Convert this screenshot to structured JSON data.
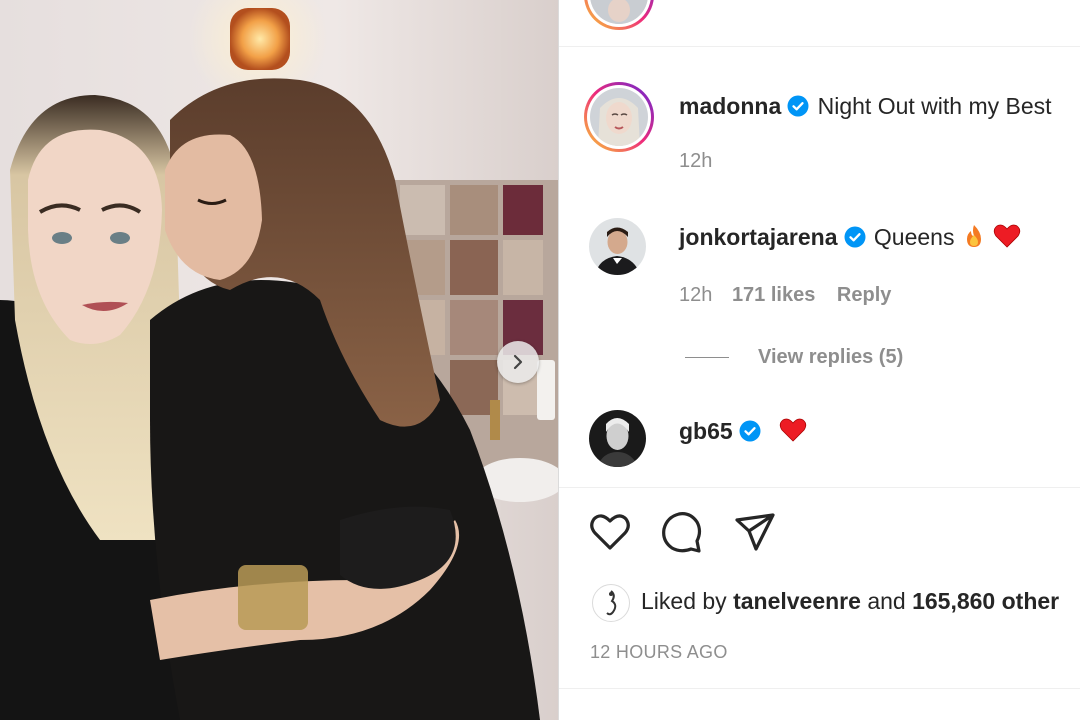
{
  "post": {
    "author": "madonna",
    "caption": "Night Out with my Best",
    "time": "12h"
  },
  "comments": [
    {
      "username": "jonkortajarena",
      "text": "Queens",
      "emoji": [
        "fire-emoji",
        "red-heart-emoji"
      ],
      "time": "12h",
      "likes": "171 likes",
      "reply": "Reply",
      "view_replies": "View replies (5)"
    },
    {
      "username": "gb65",
      "emoji": [
        "red-heart-emoji"
      ]
    }
  ],
  "actions": {
    "icons": [
      "heart-icon",
      "comment-icon",
      "share-icon"
    ]
  },
  "likes": {
    "prefix": "Liked by",
    "user": "tanelveenre",
    "and": "and",
    "count": "165,860 other"
  },
  "timestamp": "12 HOURS AGO",
  "colors": {
    "verified": "#0095f6",
    "text": "#262626",
    "muted": "#8e8e8e",
    "heart": "#ed1c24"
  }
}
